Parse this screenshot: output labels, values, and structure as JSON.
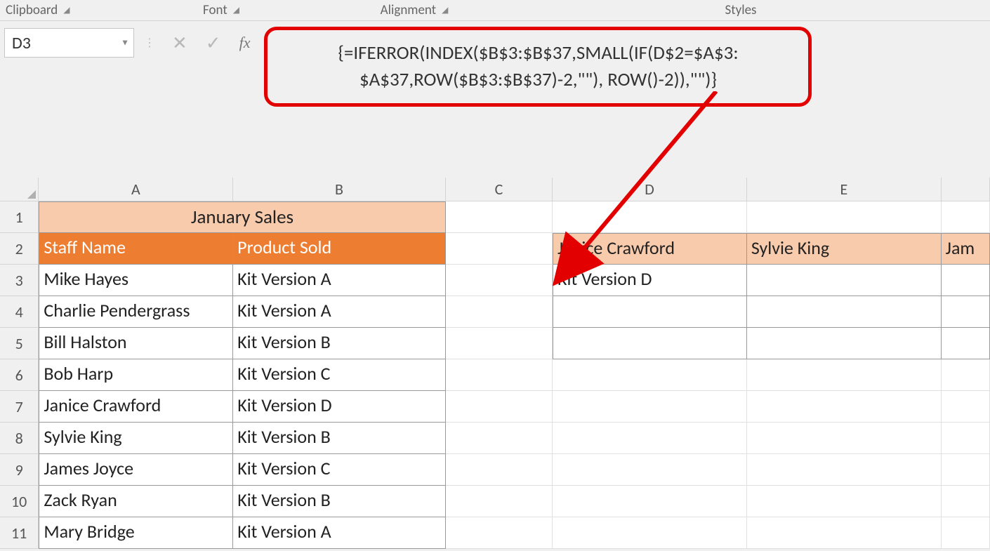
{
  "ribbon": {
    "clipboard": "Clipboard",
    "font": "Font",
    "alignment": "Alignment",
    "styles": "Styles"
  },
  "formulaBar": {
    "nameBox": "D3",
    "fxLabel": "fx",
    "formulaLine1": "{=IFERROR(INDEX($B$3:$B$37,SMALL(IF(D$2=$A$3:",
    "formulaLine2": "$A$37,ROW($B$3:$B$37)-2,\"\"), ROW()-2)),\"\")}"
  },
  "columns": {
    "A": "A",
    "B": "B",
    "C": "C",
    "D": "D",
    "E": "E"
  },
  "rows": [
    "1",
    "2",
    "3",
    "4",
    "5",
    "6",
    "7",
    "8",
    "9",
    "10",
    "11"
  ],
  "sheet": {
    "title": "January Sales",
    "headerA": "Staff Name",
    "headerB": "Product Sold",
    "data": [
      {
        "a": "Mike Hayes",
        "b": "Kit Version A"
      },
      {
        "a": "Charlie Pendergrass",
        "b": "Kit Version A"
      },
      {
        "a": "Bill Halston",
        "b": "Kit Version B"
      },
      {
        "a": "Bob Harp",
        "b": "Kit Version C"
      },
      {
        "a": "Janice Crawford",
        "b": "Kit Version D"
      },
      {
        "a": "Sylvie King",
        "b": "Kit Version B"
      },
      {
        "a": "James Joyce",
        "b": "Kit Version C"
      },
      {
        "a": "Zack Ryan",
        "b": "Kit Version B"
      },
      {
        "a": "Mary Bridge",
        "b": "Kit Version A"
      }
    ],
    "lookup": {
      "d2": "Janice Crawford",
      "e2": "Sylvie King",
      "f2": "Jam",
      "d3": "Kit Version D"
    }
  }
}
